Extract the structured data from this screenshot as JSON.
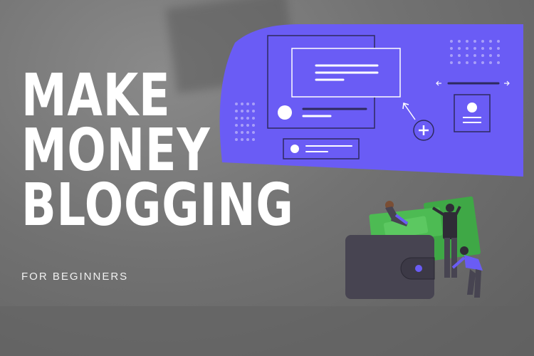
{
  "title": {
    "line1": "MAKE",
    "line2": "MONEY",
    "line3": "BLOGGING"
  },
  "subtitle": "FOR BEGINNERS",
  "colors": {
    "accent": "#6a5cf5",
    "headline": "#ffffff",
    "wallet": "#474451",
    "money": "#47b34c"
  },
  "icons": [
    "plus-icon",
    "profile-card-icon",
    "arrow-left-icon",
    "arrow-right-icon"
  ]
}
